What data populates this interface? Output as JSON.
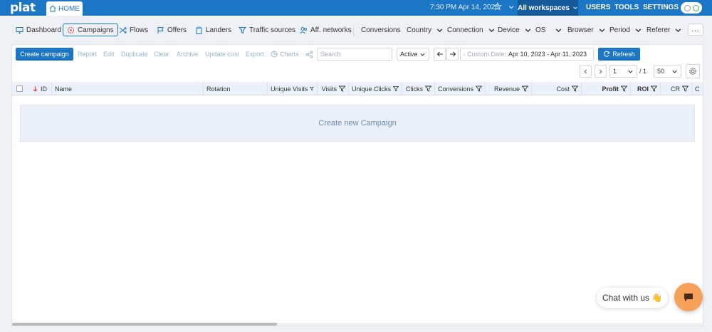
{
  "app": {
    "logo": "plat",
    "home_tab": "HOME"
  },
  "topbar": {
    "datetime": "7:30 PM Apr 14, 2023",
    "workspace": "All workspaces",
    "links": [
      "USERS",
      "TOOLS",
      "SETTINGS"
    ]
  },
  "nav": {
    "items": [
      {
        "label": "Dashboard",
        "icon": "monitor-icon"
      },
      {
        "label": "Campaigns",
        "icon": "target-icon",
        "active": true
      },
      {
        "label": "Flows",
        "icon": "shuffle-icon"
      },
      {
        "label": "Offers",
        "icon": "flag-icon"
      },
      {
        "label": "Landers",
        "icon": "clipboard-icon"
      },
      {
        "label": "Traffic sources",
        "icon": "filter-icon"
      },
      {
        "label": "Aff. networks",
        "icon": "users-icon"
      }
    ],
    "reports": [
      "Conversions",
      "Country",
      "Connection",
      "Device",
      "OS",
      "Browser",
      "Period",
      "Referer"
    ],
    "more": "..."
  },
  "toolbar": {
    "create": "Create campaign",
    "actions": [
      "Report",
      "Edit",
      "Duplicate",
      "Clear",
      "Archive",
      "Update cost",
      "Export"
    ],
    "charts": "Charts",
    "search_placeholder": "Search",
    "status": "Active",
    "date_label": "Custom Date:",
    "date_range": "Apr 10, 2023 - Apr 11, 2023",
    "refresh": "Refresh"
  },
  "pagination": {
    "page": "1",
    "total": "/ 1",
    "per_page": "50"
  },
  "table": {
    "columns": [
      "ID",
      "Name",
      "Rotation",
      "Unique Visits",
      "Visits",
      "Unique Clicks",
      "Clicks",
      "Conversions",
      "Revenue",
      "Cost",
      "Profit",
      "ROI",
      "CR",
      "C"
    ],
    "empty_text": "Create new Campaign"
  },
  "chat": {
    "label": "Chat with us",
    "emoji": "👋"
  },
  "colors": {
    "primary": "#1c76c6",
    "topbar": "#1c76c6",
    "workspace": "#14599a",
    "chat": "#f6a15a",
    "header_bg": "#eaf1fa"
  }
}
